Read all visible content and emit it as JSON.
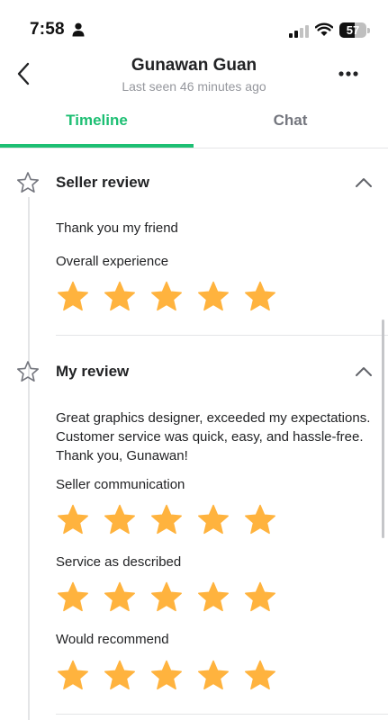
{
  "status_bar": {
    "time": "7:58",
    "battery_level": "57",
    "battery_fraction": 0.57
  },
  "header": {
    "title": "Gunawan Guan",
    "subtitle": "Last seen 46 minutes ago",
    "icons": {
      "back": "chevron-left-icon",
      "more": "more-horizontal-icon"
    }
  },
  "tabs": [
    {
      "label": "Timeline",
      "active": true
    },
    {
      "label": "Chat",
      "active": false
    }
  ],
  "colors": {
    "accent": "#1dbf73",
    "star": "#ffb33e",
    "text": "#222325",
    "muted": "#95979d"
  },
  "seller_review": {
    "title": "Seller review",
    "comment": "Thank you my friend",
    "ratings": [
      {
        "label": "Overall experience",
        "stars": 5,
        "max": 5
      }
    ]
  },
  "my_review": {
    "title": "My review",
    "comment": "Great graphics designer, exceeded my expectations. Customer service was quick, easy, and hassle-free. Thank you, Gunawan!",
    "ratings": [
      {
        "label": "Seller communication",
        "stars": 5,
        "max": 5
      },
      {
        "label": "Service as described",
        "stars": 5,
        "max": 5
      },
      {
        "label": "Would recommend",
        "stars": 5,
        "max": 5
      }
    ]
  }
}
